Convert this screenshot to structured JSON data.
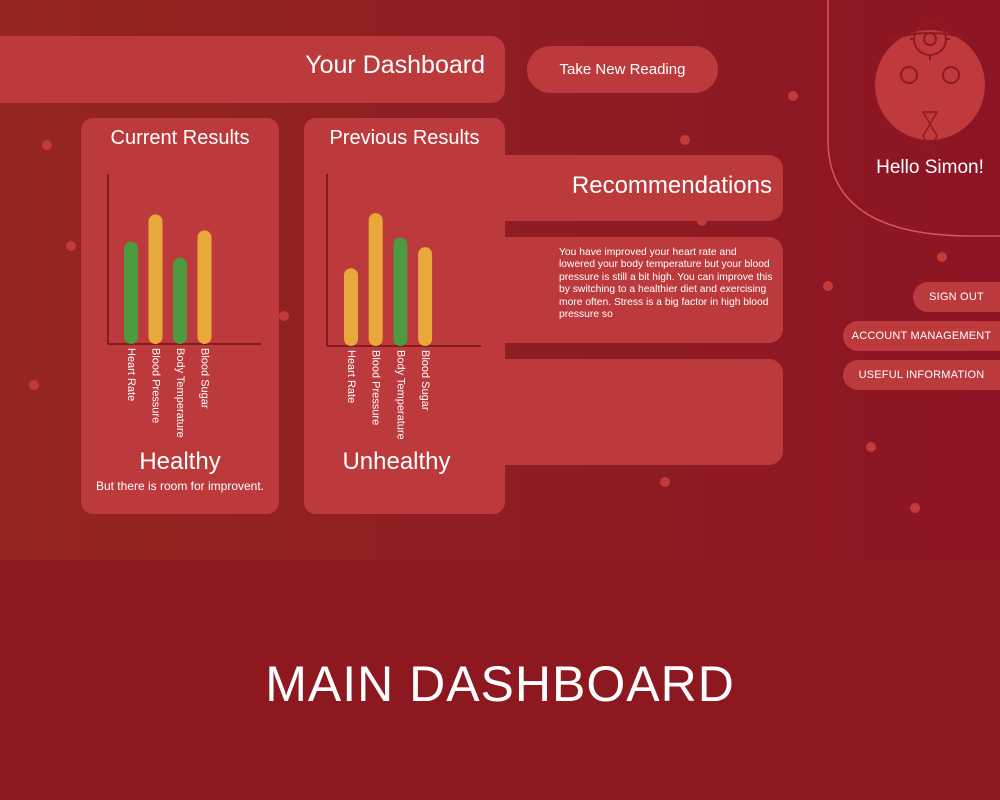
{
  "header": {
    "title": "Your Dashboard",
    "take_reading_label": "Take New Reading"
  },
  "current": {
    "title": "Current Results",
    "status": "Healthy",
    "status_note": "But there is room for improvent."
  },
  "previous": {
    "title": "Previous Results",
    "status": "Unhealthy"
  },
  "recommendations": {
    "title": "Recommendations",
    "text": "You have improved your heart rate and lowered your body temperature but your blood pressure is still a bit high. You can improve this by switching to a healthier diet and exercising more often. Stress is a big factor in high blood pressure so"
  },
  "profile": {
    "greeting": "Hello Simon!",
    "avatar_icon": "doctor-avatar-icon"
  },
  "menu": {
    "sign_out": "SIGN OUT",
    "account": "ACCOUNT MANAGEMENT",
    "info": "USEFUL INFORMATION"
  },
  "footer": {
    "title": "MAIN DASHBOARD"
  },
  "colors": {
    "green": "#4d9a40",
    "orange": "#e8a83a",
    "panel": "#bd3a3c",
    "background": "#8e1820"
  },
  "chart_data": [
    {
      "type": "bar",
      "title": "Current Results",
      "categories": [
        "Heart Rate",
        "Blood Pressure",
        "Body Temperature",
        "Blood Sugar"
      ],
      "values": [
        64,
        81,
        54,
        71
      ],
      "colors": [
        "#4d9a40",
        "#e8a83a",
        "#4d9a40",
        "#e8a83a"
      ],
      "ylim": [
        0,
        100
      ]
    },
    {
      "type": "bar",
      "title": "Previous Results",
      "categories": [
        "Heart Rate",
        "Blood Pressure",
        "Body Temperature",
        "Blood Sugar"
      ],
      "values": [
        48,
        82,
        67,
        61
      ],
      "colors": [
        "#e8a83a",
        "#e8a83a",
        "#4d9a40",
        "#e8a83a"
      ],
      "ylim": [
        0,
        100
      ]
    }
  ]
}
